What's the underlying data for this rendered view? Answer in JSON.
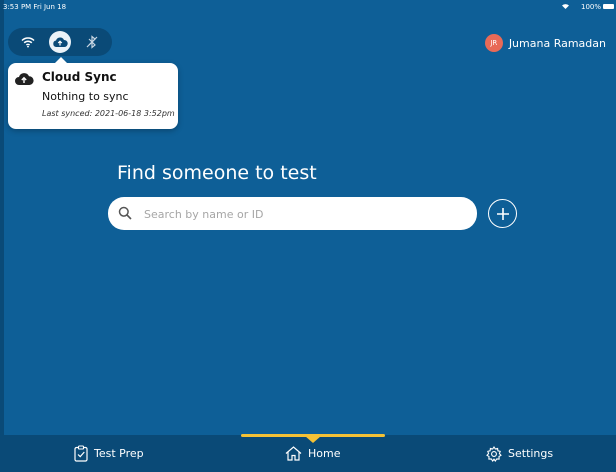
{
  "status_bar": {
    "time": "3:53 PM  Fri Jun 18",
    "battery": "100%"
  },
  "connection": {
    "icons": [
      "wifi-icon",
      "cloud-sync-icon",
      "bluetooth-off-icon"
    ]
  },
  "user": {
    "initials": "JR",
    "name": "Jumana Ramadan",
    "avatar_color": "#e86a57"
  },
  "cloud_popover": {
    "title": "Cloud Sync",
    "status": "Nothing to sync",
    "last_synced": "Last synced: 2021-06-18 3:52pm"
  },
  "main": {
    "heading": "Find someone to test",
    "search_placeholder": "Search by name or ID",
    "search_value": ""
  },
  "nav": {
    "items": [
      {
        "label": "Test Prep",
        "icon": "clipboard-check-icon"
      },
      {
        "label": "Home",
        "icon": "home-icon",
        "active": true
      },
      {
        "label": "Settings",
        "icon": "gear-icon"
      }
    ],
    "accent": "#f4c236"
  },
  "colors": {
    "background": "#0e5f97",
    "dark": "#0a4a77"
  }
}
